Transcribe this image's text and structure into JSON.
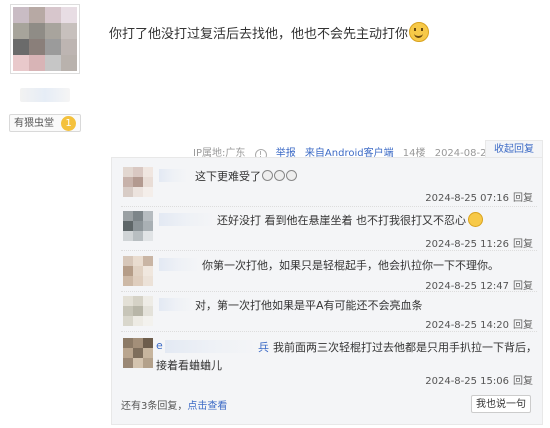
{
  "author": {
    "badge_label": "有猥虫堂",
    "badge_level": "1",
    "avatar_colors": [
      "#c9bcc4",
      "#b7a9a4",
      "#d7c6cc",
      "#e8dde4",
      "#a7a49b",
      "#8f8c86",
      "#a8a49d",
      "#c7c0bd",
      "#6b6b6b",
      "#8a7f7a",
      "#9b9b9b",
      "#bdb5b2",
      "#e9c9cb",
      "#d8b4b6",
      "#c6c6c6",
      "#b9b2ad"
    ]
  },
  "post": {
    "text": "你打了他没打过复活后去找他，他也不会先主动打你",
    "ip": "IP属地:广东",
    "report": "举报",
    "client": "来自Android客户端",
    "floor": "14楼",
    "datetime": "2024-08-24 23:59",
    "collapse_label": "收起回复"
  },
  "replies": [
    {
      "text": "这下更难受了",
      "time": "2024-8-25 07:16",
      "reply_label": "回复",
      "avatar": [
        "#e2d7d0",
        "#d9c8c2",
        "#f0e6e0",
        "#c7b2aa",
        "#b39a90",
        "#e9ddd6",
        "#d8ccc6",
        "#ece3de",
        "#f4eeea"
      ]
    },
    {
      "text": "还好没打 看到他在悬崖坐着 也不打我很打又不忍心",
      "time": "2024-8-25 11:26",
      "reply_label": "回复",
      "avatar": [
        "#9aa0a3",
        "#7d8589",
        "#b6bcc0",
        "#5e6668",
        "#8c9498",
        "#a9b0b4",
        "#d0d4d6",
        "#b8bec1",
        "#e1e4e6"
      ]
    },
    {
      "text": "你第一次打他，如果只是轻棍起手，他会扒拉你一下不理你。",
      "time": "2024-8-25 12:47",
      "reply_label": "回复",
      "avatar": [
        "#d7c7b9",
        "#e9dccf",
        "#c9b5a4",
        "#b59d88",
        "#e1d2c3",
        "#f0e7de",
        "#cdb9a6",
        "#dfcebe",
        "#ece2d8"
      ]
    },
    {
      "text": "对，第一次打他如果是平A有可能还不会亮血条",
      "time": "2024-8-25 14:20",
      "reply_label": "回复",
      "avatar": [
        "#e3e0d6",
        "#d5d2c6",
        "#eeece6",
        "#c7c5b8",
        "#b8b6a8",
        "#e4e2da",
        "#d9d7cc",
        "#edebe4",
        "#f3f2ee"
      ]
    },
    {
      "text": "我前面两三次轻棍打过去他都是只用手扒拉一下背后，",
      "text2": "接着看蛐蛐儿",
      "name_prefix": "e",
      "name_suffix": "兵",
      "time": "2024-8-25 15:06",
      "reply_label": "回复",
      "avatar": [
        "#8c7a66",
        "#a38f79",
        "#6d5d4c",
        "#b9a58e",
        "#7e6e5c",
        "#c7b59e",
        "#9a8875",
        "#d4c4af",
        "#b3a18b"
      ]
    }
  ],
  "footer": {
    "more_prefix": "还有3条回复，",
    "more_link": "点击查看",
    "say_button": "我也说一句"
  }
}
